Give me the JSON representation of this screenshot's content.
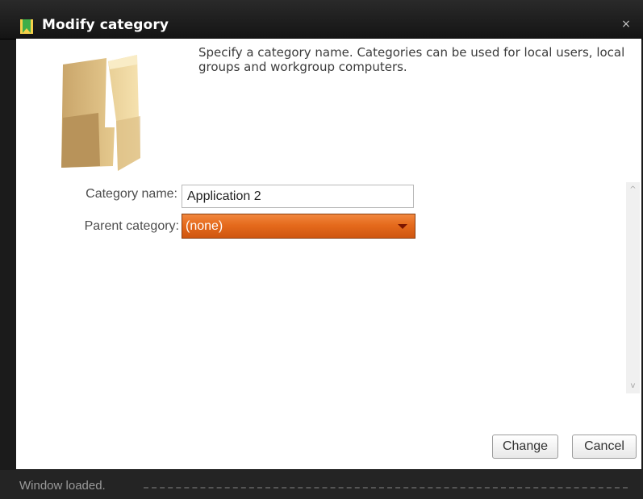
{
  "window": {
    "title": "Modify category",
    "close_glyph": "×",
    "title_icon": "category-bookmark-icon"
  },
  "header": {
    "icon": "folder-icon",
    "description": "Specify a category name. Categories can be used for local users, local groups and workgroup computers."
  },
  "form": {
    "category_name_label": "Category name:",
    "category_name_value": "Application 2",
    "parent_category_label": "Parent category:",
    "parent_category_value": "(none)"
  },
  "scrollbar": {
    "up_glyph": "^",
    "down_glyph": "v"
  },
  "buttons": {
    "change": "Change",
    "cancel": "Cancel"
  },
  "status": {
    "text": "Window loaded."
  },
  "colors": {
    "titlebar": "#1b1b1b",
    "accent_orange": "#e56a1c",
    "title_icon_yellow": "#f5d04a",
    "title_icon_green": "#3fae49"
  }
}
